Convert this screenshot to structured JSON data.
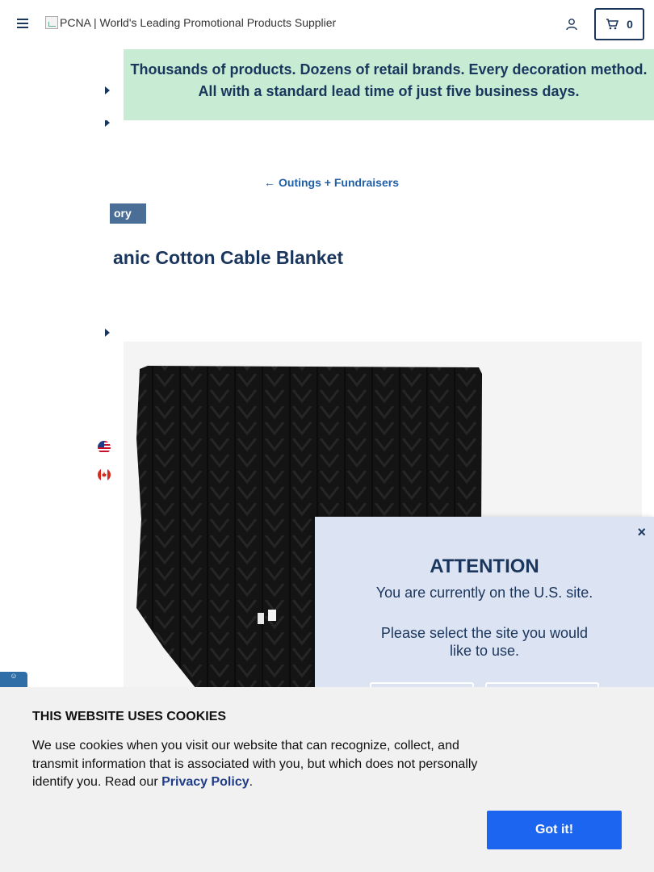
{
  "header": {
    "logo_alt": "PCNA | World's Leading Promotional Products Supplier",
    "cart_count": "0",
    "icons": {
      "menu": "hamburger-menu-icon",
      "account": "user-icon",
      "cart": "cart-icon"
    }
  },
  "banner": {
    "text": "Thousands of products. Dozens of retail brands. Every decoration method. All with a standard lead time of just five business days."
  },
  "breadcrumb": {
    "back_arrow": "←",
    "back_label": "Outings + Fundraisers"
  },
  "product": {
    "badge": "ory",
    "title": "anic Cotton Cable Blanket"
  },
  "attention": {
    "close": "×",
    "heading": "ATTENTION",
    "current_site": "You are currently on the U.S. site.",
    "prompt": "Please select the site you would like to use."
  },
  "cookie": {
    "heading": "THIS WEBSITE USES COOKIES",
    "body": "We use cookies when you visit our website that can recognize, collect, and transmit information that is associated with you, but which does not personally identify you. Read our ",
    "link_label": "Privacy Policy",
    "period": ".",
    "accept_label": "Got it!"
  },
  "colors": {
    "brand_navy": "#1b365d",
    "banner_bg": "#c8ecd3",
    "popup_bg": "#dce3f2",
    "accept_button": "#1c65f0"
  }
}
